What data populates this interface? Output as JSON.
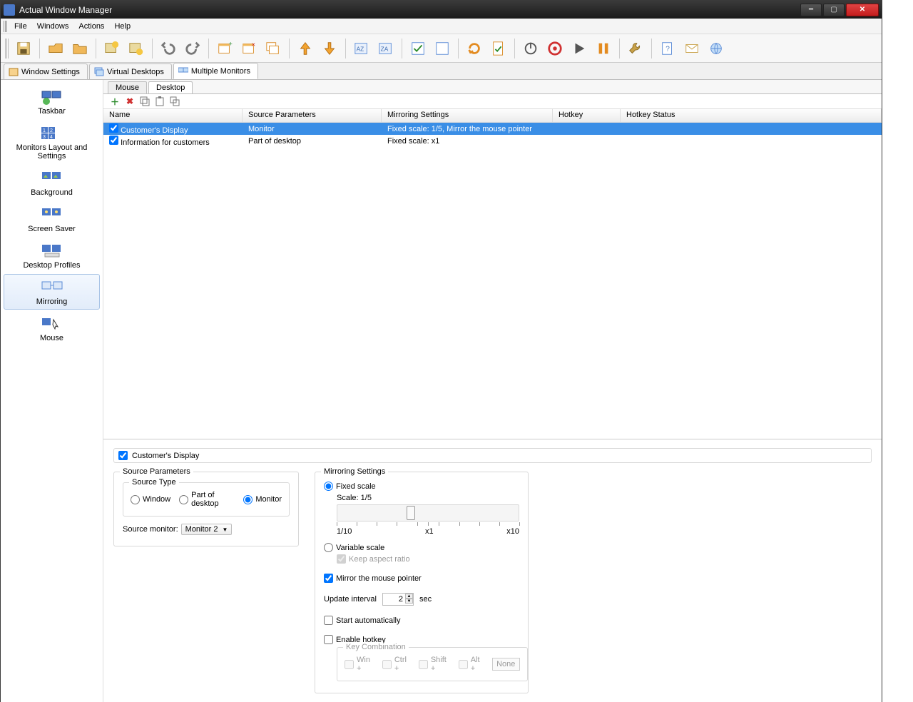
{
  "titlebar": {
    "title": "Actual Window Manager"
  },
  "menu": {
    "file": "File",
    "windows": "Windows",
    "actions": "Actions",
    "help": "Help"
  },
  "main_tabs": {
    "window_settings": "Window Settings",
    "virtual_desktops": "Virtual Desktops",
    "multiple_monitors": "Multiple Monitors"
  },
  "nav": {
    "taskbar": "Taskbar",
    "layout": "Monitors Layout and Settings",
    "background": "Background",
    "screensaver": "Screen Saver",
    "profiles": "Desktop Profiles",
    "mirroring": "Mirroring",
    "mouse": "Mouse"
  },
  "sub_tabs": {
    "mouse": "Mouse",
    "desktop": "Desktop"
  },
  "table": {
    "headers": {
      "name": "Name",
      "src": "Source Parameters",
      "mirror": "Mirroring Settings",
      "hotkey": "Hotkey",
      "hotkey_status": "Hotkey Status"
    },
    "rows": [
      {
        "name": "Customer's Display",
        "src": "Monitor",
        "mirror": "Fixed scale: 1/5, Mirror the mouse pointer",
        "hotkey": "",
        "hotkey_status": "",
        "selected": true
      },
      {
        "name": "Information for customers",
        "src": "Part of desktop",
        "mirror": "Fixed scale: x1",
        "hotkey": "",
        "hotkey_status": "",
        "selected": false
      }
    ]
  },
  "detail": {
    "title": "Customer's Display",
    "source_parameters": "Source Parameters",
    "source_type": "Source Type",
    "rt_window": "Window",
    "rt_part": "Part of desktop",
    "rt_monitor": "Monitor",
    "source_monitor_label": "Source monitor:",
    "source_monitor_value": "Monitor 2",
    "mirroring_settings": "Mirroring Settings",
    "fixed_scale": "Fixed scale",
    "scale_label": "Scale:",
    "scale_value": "1/5",
    "tick_min": "1/10",
    "tick_mid": "x1",
    "tick_max": "x10",
    "variable_scale": "Variable scale",
    "keep_aspect": "Keep aspect ratio",
    "mirror_pointer": "Mirror the mouse pointer",
    "update_interval_label": "Update interval",
    "update_interval_value": "2",
    "update_interval_unit": "sec",
    "start_auto": "Start automatically",
    "enable_hotkey": "Enable hotkey",
    "key_combo": "Key Combination",
    "kc_win": "Win +",
    "kc_ctrl": "Ctrl +",
    "kc_shift": "Shift +",
    "kc_alt": "Alt +",
    "kc_none": "None"
  }
}
